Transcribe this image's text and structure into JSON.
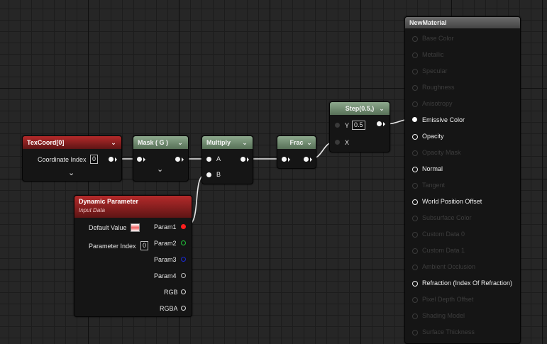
{
  "nodes": {
    "texcoord": {
      "title": "TexCoord[0]",
      "input_label": "Coordinate Index",
      "input_value": "0"
    },
    "mask": {
      "title": "Mask ( G )"
    },
    "multiply": {
      "title": "Multiply",
      "input_a": "A",
      "input_b": "B"
    },
    "frac": {
      "title": "Frac"
    },
    "step": {
      "title": "Step(0.5,)",
      "input_y": "Y",
      "y_value": "0.5",
      "input_x": "X"
    },
    "dynamic": {
      "title": "Dynamic Parameter",
      "subtitle": "Input Data",
      "default_value_label": "Default Value",
      "parameter_index_label": "Parameter Index",
      "parameter_index_value": "0",
      "outputs": [
        "Param1",
        "Param2",
        "Param3",
        "Param4",
        "RGB",
        "RGBA"
      ]
    },
    "material": {
      "title": "NewMaterial",
      "inputs": [
        "Base Color",
        "Metallic",
        "Specular",
        "Roughness",
        "Anisotropy",
        "Emissive Color",
        "Opacity",
        "Opacity Mask",
        "Normal",
        "Tangent",
        "World Position Offset",
        "Subsurface Color",
        "Custom Data 0",
        "Custom Data 1",
        "Ambient Occlusion",
        "Refraction (Index Of Refraction)",
        "Pixel Depth Offset",
        "Shading Model",
        "Surface Thickness"
      ],
      "active_inputs": [
        "Emissive Color",
        "Opacity",
        "Normal",
        "World Position Offset",
        "Refraction (Index Of Refraction)"
      ]
    }
  },
  "colors": {
    "wire": "#ffffff",
    "param1_pin": "#ff1e1e",
    "param2_pin": "#21c43a",
    "param3_pin": "#1b2bd6",
    "grid_background": "#262626"
  },
  "icons": {
    "dropdown": "chevron-down-icon",
    "output_pin": "pin-output-icon",
    "input_pin": "pin-input-icon"
  }
}
